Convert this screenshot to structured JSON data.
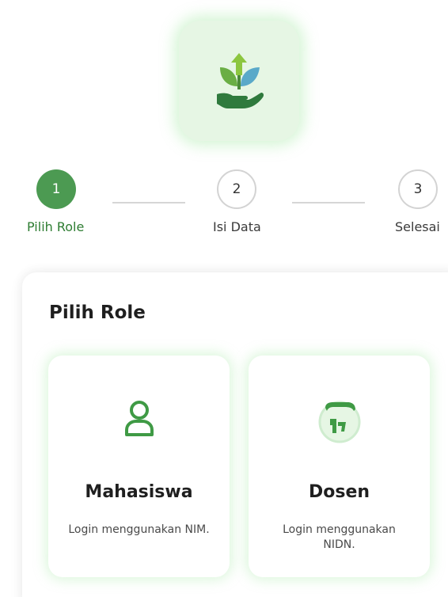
{
  "stepper": {
    "steps": [
      {
        "number": "1",
        "label": "Pilih Role",
        "state": "active"
      },
      {
        "number": "2",
        "label": "Isi Data",
        "state": "pending"
      },
      {
        "number": "3",
        "label": "Selesai",
        "state": "pending"
      }
    ]
  },
  "panel": {
    "title": "Pilih Role"
  },
  "roles": [
    {
      "title": "Mahasiswa",
      "description": "Login menggunakan NIM.",
      "icon": "user-icon"
    },
    {
      "title": "Dosen",
      "description": "Login menggunakan NIDN.",
      "icon": "lecturer-icon"
    }
  ],
  "colors": {
    "accent": "#4c9a52",
    "accent_dark": "#2e7d32",
    "logo_bg": "#e6f6e4",
    "glow": "#96e496"
  },
  "logo": {
    "icon": "plant-growth-hand-icon"
  }
}
